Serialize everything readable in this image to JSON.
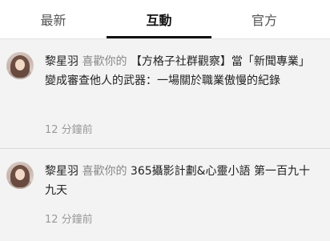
{
  "tabs": [
    {
      "label": "最新"
    },
    {
      "label": "互動"
    },
    {
      "label": "官方"
    }
  ],
  "notifications": [
    {
      "user": "黎星羽",
      "action": "喜歡你的",
      "title": "【方格子社群觀察】當「新聞專業」變成審查他人的武器：一場關於職業傲慢的紀錄",
      "time": "12 分鐘前"
    },
    {
      "user": "黎星羽",
      "action": "喜歡你的",
      "title": "365攝影計劃&心靈小語 第一百九十九天",
      "time": "12 分鐘前"
    }
  ]
}
